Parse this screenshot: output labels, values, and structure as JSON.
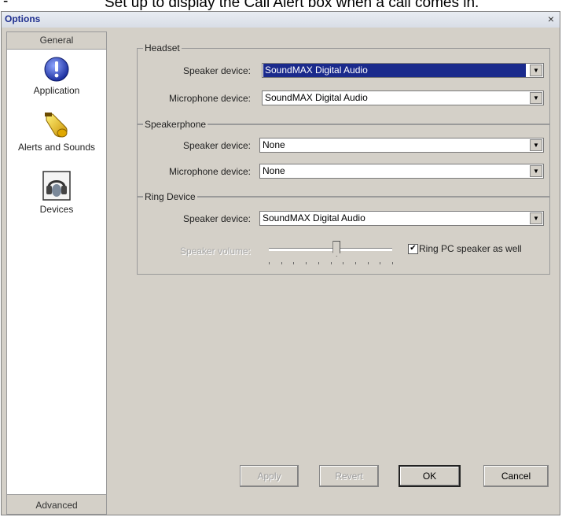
{
  "caption": {
    "bullet": "-",
    "text": "Set up to display the Call Alert box when a call comes in."
  },
  "window": {
    "title": "Options",
    "close_glyph": "×"
  },
  "sidebar": {
    "header": "General",
    "footer": "Advanced",
    "items": [
      {
        "label": "Application",
        "icon": "info-icon"
      },
      {
        "label": "Alerts and Sounds",
        "icon": "bell-icon"
      },
      {
        "label": "Devices",
        "icon": "headset-icon"
      }
    ]
  },
  "headset": {
    "legend": "Headset",
    "speaker_label": "Speaker device:",
    "speaker_value": "SoundMAX Digital Audio",
    "mic_label": "Microphone device:",
    "mic_value": "SoundMAX Digital Audio"
  },
  "speakerphone": {
    "legend": "Speakerphone",
    "speaker_label": "Speaker device:",
    "speaker_value": "None",
    "mic_label": "Microphone device:",
    "mic_value": "None"
  },
  "ring": {
    "legend": "Ring Device",
    "speaker_label": "Speaker device:",
    "speaker_value": "SoundMAX Digital Audio",
    "volume_label": "Speaker volume:",
    "volume_level": 0.55,
    "checkbox_label": "Ring PC speaker as well",
    "checkbox_checked": true,
    "checkbox_glyph": "✔"
  },
  "buttons": {
    "apply": "Apply",
    "revert": "Revert",
    "ok": "OK",
    "cancel": "Cancel"
  },
  "colors": {
    "dialog_bg": "#d4d0c8",
    "selection_bg": "#1a2a8c",
    "title_text": "#1f2f8f"
  }
}
